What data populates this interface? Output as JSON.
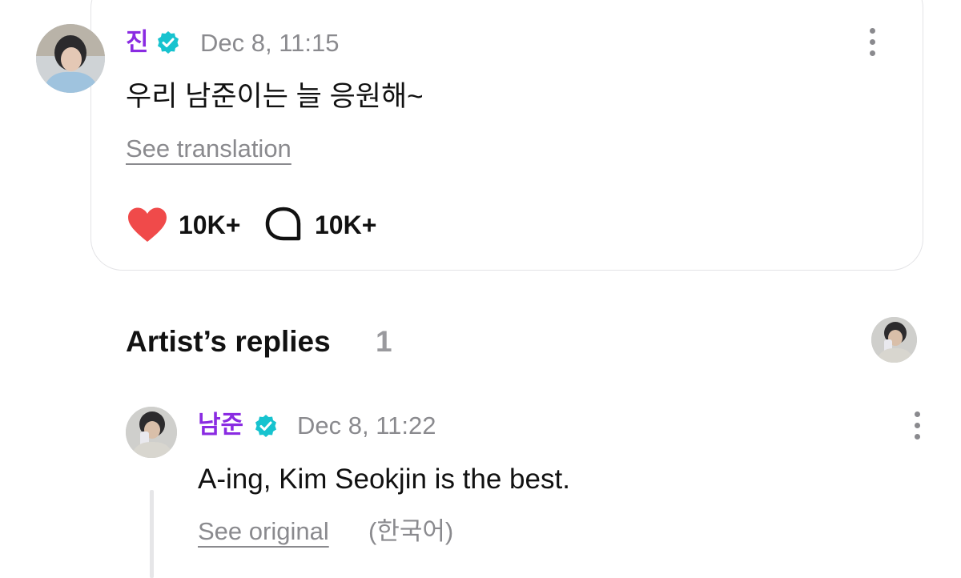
{
  "post": {
    "author": "진",
    "timestamp": "Dec 8, 11:15",
    "text": "우리 남준이는 늘 응원해~",
    "translate_link": "See translation",
    "likes": "10K+",
    "comments": "10K+",
    "icons": {
      "verified": "verified-badge-icon",
      "like": "heart-icon",
      "comment": "comment-bubble-icon",
      "more": "more-options-icon"
    }
  },
  "replies_section": {
    "title": "Artist’s replies",
    "count": "1"
  },
  "reply": {
    "author": "남준",
    "timestamp": "Dec 8, 11:22",
    "text": "A-ing, Kim Seokjin is the best.",
    "original_link": "See original",
    "original_lang": "(한국어)"
  },
  "colors": {
    "accent": "#8a2be2",
    "verified": "#17c3cf",
    "like": "#f04a4a",
    "muted": "#8a8a8e"
  }
}
